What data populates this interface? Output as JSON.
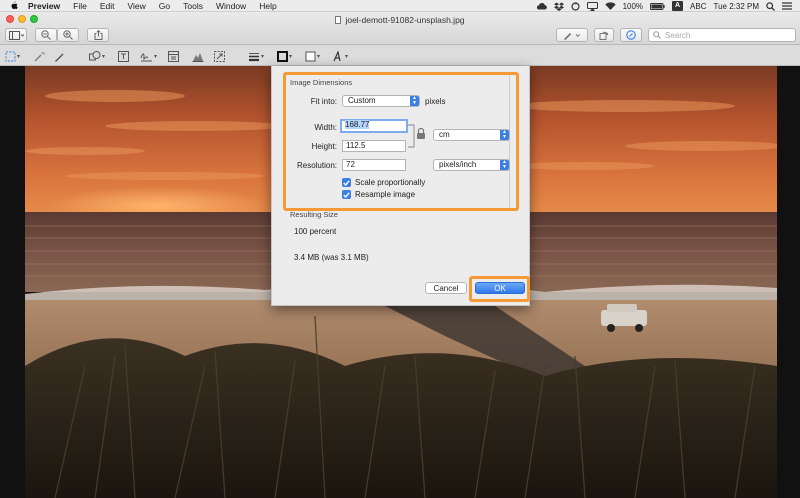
{
  "menubar": {
    "items": [
      "Preview",
      "File",
      "Edit",
      "View",
      "Go",
      "Tools",
      "Window",
      "Help"
    ],
    "battery": "100%",
    "input_badge": "A",
    "input_source": "ABC",
    "clock": "Tue 2:32 PM"
  },
  "window": {
    "title": "joel-demott-91082-unsplash.jpg",
    "search_placeholder": "Search"
  },
  "dialog": {
    "image_dimensions_title": "Image Dimensions",
    "fit_into_label": "Fit into:",
    "fit_into_value": "Custom",
    "fit_into_unit": "pixels",
    "width_label": "Width:",
    "width_value": "168.77",
    "height_label": "Height:",
    "height_value": "112.5",
    "unit_value": "cm",
    "resolution_label": "Resolution:",
    "resolution_value": "72",
    "resolution_unit": "pixels/inch",
    "scale_label": "Scale proportionally",
    "scale_checked": true,
    "resample_label": "Resample image",
    "resample_checked": true,
    "resulting_size_title": "Resulting Size",
    "percent_text": "100 percent",
    "size_text": "3.4 MB (was 3.1 MB)",
    "cancel_label": "Cancel",
    "ok_label": "OK"
  },
  "colors": {
    "highlight": "#f59a35",
    "accent": "#3b7ee8"
  }
}
